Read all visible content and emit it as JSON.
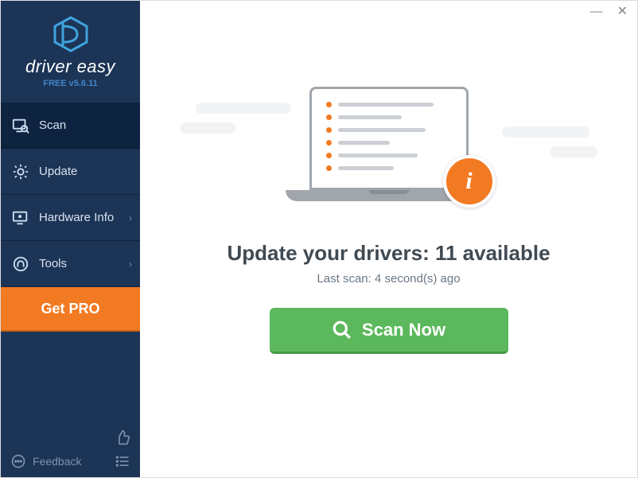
{
  "brand": "driver easy",
  "version": "FREE v5.6.11",
  "sidebar": {
    "items": [
      {
        "label": "Scan"
      },
      {
        "label": "Update"
      },
      {
        "label": "Hardware Info"
      },
      {
        "label": "Tools"
      }
    ],
    "get_pro": "Get PRO",
    "feedback": "Feedback"
  },
  "main": {
    "headline": "Update your drivers: 11 available",
    "subline": "Last scan: 4 second(s) ago",
    "scan_button": "Scan Now",
    "info_badge_letter": "i"
  }
}
